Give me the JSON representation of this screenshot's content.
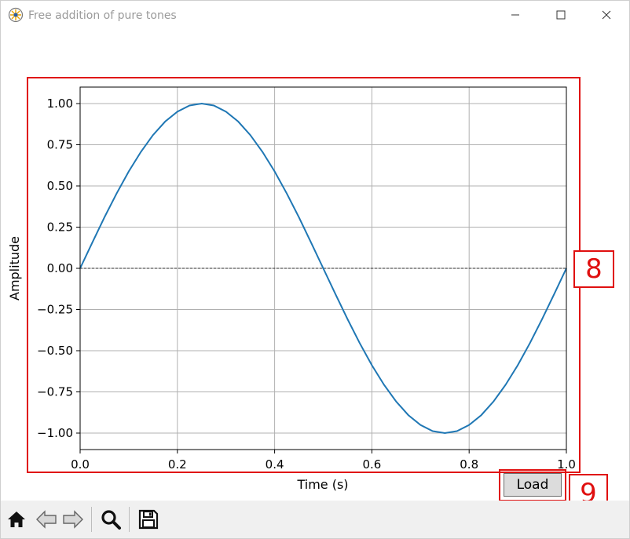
{
  "window": {
    "title": "Free addition of pure tones",
    "controls": {
      "minimize_icon": "minimize-icon",
      "maximize_icon": "maximize-icon",
      "close_icon": "close-icon"
    }
  },
  "annotations": [
    {
      "number": "8",
      "target": "plot-area"
    },
    {
      "number": "9",
      "target": "load-button"
    }
  ],
  "load_button": {
    "label": "Load"
  },
  "toolbar": {
    "tools": [
      {
        "name": "home",
        "icon": "home-icon"
      },
      {
        "name": "back",
        "icon": "arrow-left-icon"
      },
      {
        "name": "forward",
        "icon": "arrow-right-icon"
      },
      {
        "name": "zoom",
        "icon": "magnifier-icon"
      },
      {
        "name": "save",
        "icon": "floppy-disk-icon"
      }
    ]
  },
  "colors": {
    "line": "#1f77b4",
    "annotation": "#e01010",
    "grid": "#b0b0b0",
    "toolbar_bg": "#f0f0f0"
  },
  "chart_data": {
    "type": "line",
    "title": "",
    "xlabel": "Time (s)",
    "ylabel": "Amplitude",
    "xlim": [
      0,
      1
    ],
    "ylim": [
      -1.1,
      1.1
    ],
    "xticks": [
      0.0,
      0.2,
      0.4,
      0.6,
      0.8,
      1.0
    ],
    "xtick_labels": [
      "0.0",
      "0.2",
      "0.4",
      "0.6",
      "0.8",
      "1.0"
    ],
    "yticks": [
      1.0,
      0.75,
      0.5,
      0.25,
      0.0,
      -0.25,
      -0.5,
      -0.75,
      -1.0
    ],
    "ytick_labels": [
      "1.00",
      "0.75",
      "0.50",
      "0.25",
      "0.00",
      "−0.25",
      "−0.50",
      "−0.75",
      "−1.00"
    ],
    "grid": true,
    "zero_line": {
      "y": 0,
      "style": "dashed"
    },
    "series": [
      {
        "x": [
          0,
          0.025,
          0.05,
          0.075,
          0.1,
          0.125,
          0.15,
          0.175,
          0.2,
          0.225,
          0.25,
          0.275,
          0.3,
          0.325,
          0.35,
          0.375,
          0.4,
          0.425,
          0.45,
          0.475,
          0.5,
          0.525,
          0.55,
          0.575,
          0.6,
          0.625,
          0.65,
          0.675,
          0.7,
          0.725,
          0.75,
          0.775,
          0.8,
          0.825,
          0.85,
          0.875,
          0.9,
          0.925,
          0.95,
          0.975,
          1.0
        ],
        "values": [
          0,
          0.156,
          0.309,
          0.454,
          0.588,
          0.707,
          0.809,
          0.891,
          0.951,
          0.988,
          1.0,
          0.988,
          0.951,
          0.891,
          0.809,
          0.707,
          0.588,
          0.454,
          0.309,
          0.156,
          0,
          -0.156,
          -0.309,
          -0.454,
          -0.588,
          -0.707,
          -0.809,
          -0.891,
          -0.951,
          -0.988,
          -1.0,
          -0.988,
          -0.951,
          -0.891,
          -0.809,
          -0.707,
          -0.588,
          -0.454,
          -0.309,
          -0.156,
          0
        ]
      }
    ]
  }
}
